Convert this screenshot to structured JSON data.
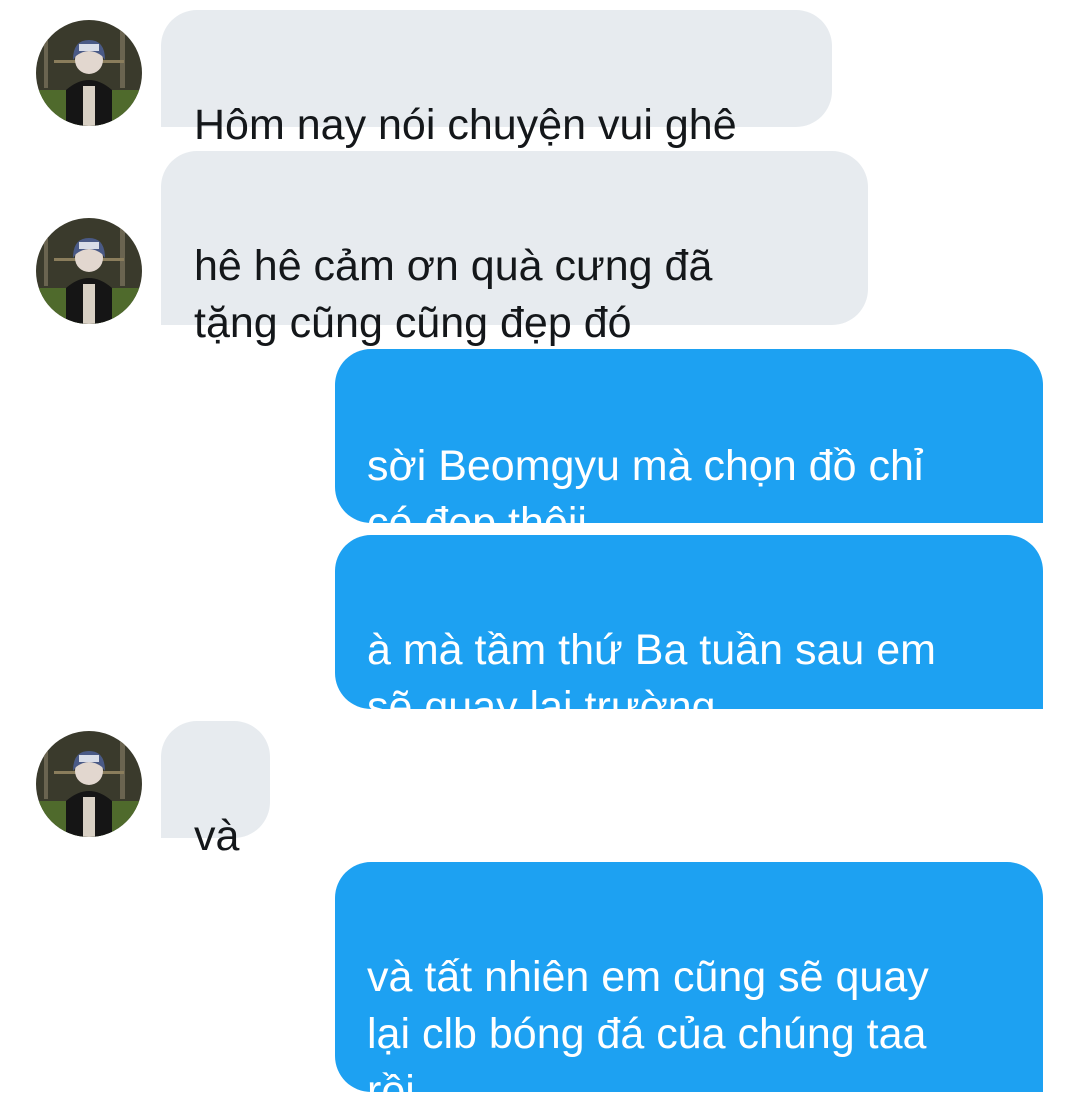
{
  "colors": {
    "incoming_bubble": "#e7ebef",
    "incoming_text": "#14171a",
    "outgoing_bubble": "#1da1f2",
    "outgoing_text": "#ffffff",
    "background": "#ffffff"
  },
  "messages": [
    {
      "sender": "other",
      "text": "Hôm nay nói chuyện vui ghê",
      "avatar": "profile-photo"
    },
    {
      "sender": "other",
      "text": "hê hê cảm ơn quà cưng đã\ntặng cũng cũng đẹp đó",
      "avatar": "profile-photo"
    },
    {
      "sender": "me",
      "text": "sời Beomgyu mà chọn đồ chỉ\ncó đẹp thôii"
    },
    {
      "sender": "me",
      "text": "à mà tầm thứ Ba tuần sau em\nsẽ quay lại trường"
    },
    {
      "sender": "other",
      "text": "và",
      "avatar": "profile-photo"
    },
    {
      "sender": "me",
      "text": "và tất nhiên em cũng sẽ quay\nlại clb bóng đá của chúng taa\nrồi"
    }
  ]
}
